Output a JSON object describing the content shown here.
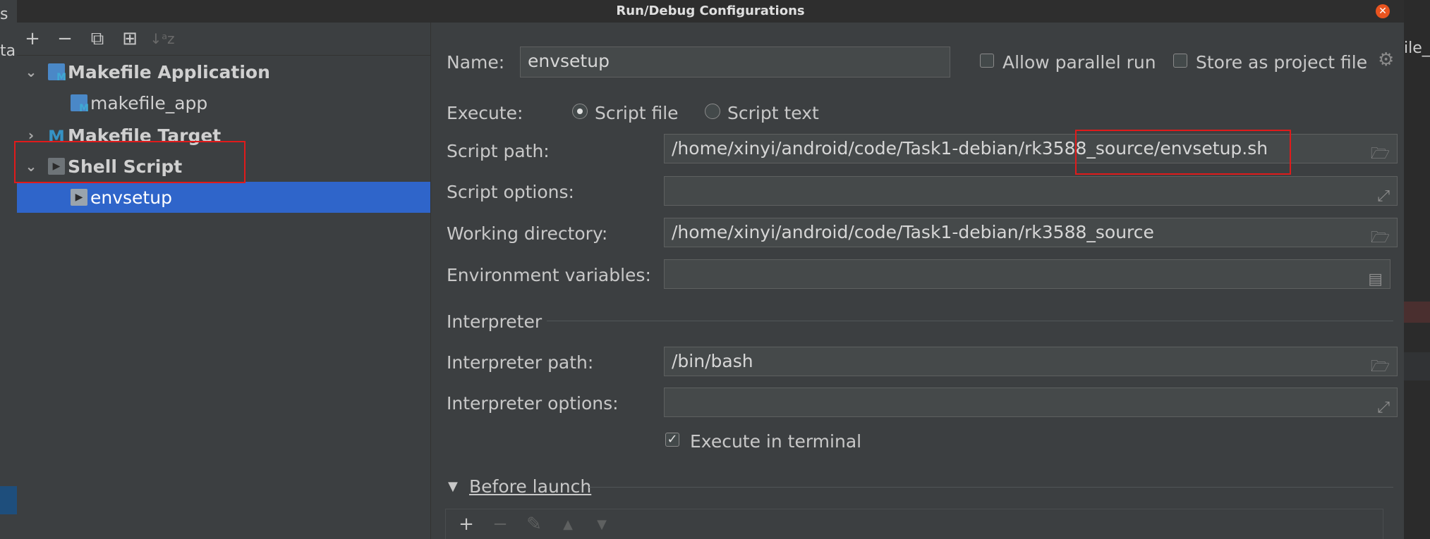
{
  "window": {
    "title": "Run/Debug Configurations"
  },
  "background_fragments": {
    "top_left": "s",
    "mid_left": "ta",
    "right_top": "ile_"
  },
  "toolbar": {
    "add": "+",
    "remove": "−",
    "copy": "⧉",
    "new_folder": "⊞",
    "sort": "↓ᵃz"
  },
  "tree": {
    "makefile_application": "Makefile Application",
    "makefile_app": "makefile_app",
    "makefile_target": "Makefile Target",
    "shell_script": "Shell Script",
    "envsetup": "envsetup"
  },
  "form": {
    "name_label": "Name:",
    "name_value": "envsetup",
    "allow_parallel_run": "Allow parallel run",
    "store_as_project_file": "Store as project file",
    "execute_label": "Execute:",
    "script_file": "Script file",
    "script_text": "Script text",
    "script_path_label": "Script path:",
    "script_path_value": "/home/xinyi/android/code/Task1-debian/rk3588_source/envsetup.sh",
    "script_options_label": "Script options:",
    "script_options_value": "",
    "working_directory_label": "Working directory:",
    "working_directory_value": "/home/xinyi/android/code/Task1-debian/rk3588_source",
    "environment_variables_label": "Environment variables:",
    "environment_variables_value": "",
    "interpreter_section": "Interpreter",
    "interpreter_path_label": "Interpreter path:",
    "interpreter_path_value": "/bin/bash",
    "interpreter_options_label": "Interpreter options:",
    "interpreter_options_value": "",
    "execute_in_terminal": "Execute in terminal",
    "before_launch": "Before launch"
  },
  "state": {
    "execute_mode": "Script file",
    "execute_in_terminal": true,
    "allow_parallel_run": false,
    "store_as_project_file": false,
    "selected_tree_item": "envsetup"
  },
  "colors": {
    "selection": "#2f65ca",
    "highlight_box": "#e01b1b",
    "close_button": "#e9541f"
  }
}
